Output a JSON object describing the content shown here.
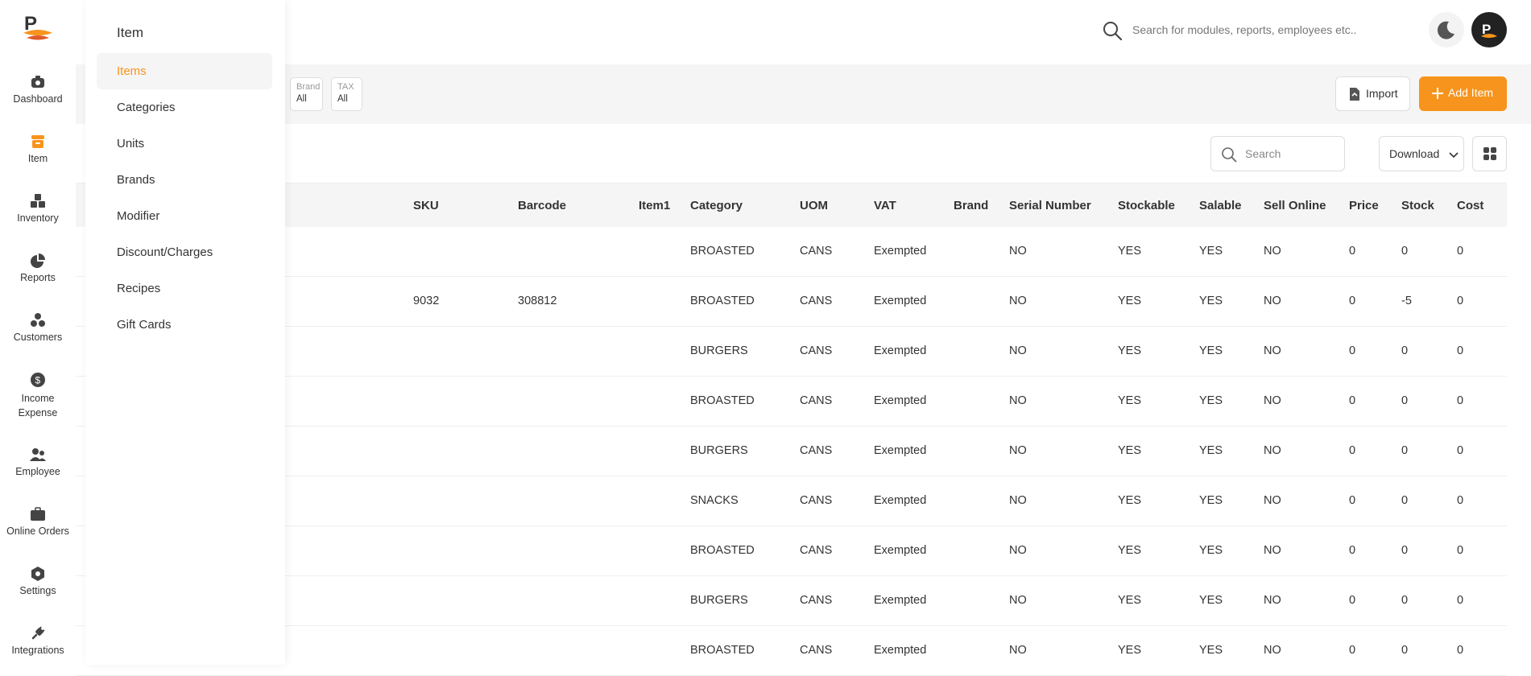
{
  "rail": [
    {
      "label": "Dashboard",
      "icon": "camera-icon"
    },
    {
      "label": "Item",
      "icon": "box-icon",
      "active": true
    },
    {
      "label": "Inventory",
      "icon": "boxes-icon"
    },
    {
      "label": "Reports",
      "icon": "pie-chart-icon"
    },
    {
      "label": "Customers",
      "icon": "users-group-icon"
    },
    {
      "label": "Income Expense",
      "icon": "dollar-icon"
    },
    {
      "label": "Employee",
      "icon": "employee-icon"
    },
    {
      "label": "Online Orders",
      "icon": "briefcase-icon"
    },
    {
      "label": "Settings",
      "icon": "settings-hex-icon"
    },
    {
      "label": "Integrations",
      "icon": "plug-icon"
    }
  ],
  "submenu": {
    "title": "Item",
    "items": [
      {
        "label": "Items",
        "active": true
      },
      {
        "label": "Categories"
      },
      {
        "label": "Units"
      },
      {
        "label": "Brands"
      },
      {
        "label": "Modifier"
      },
      {
        "label": "Discount/Charges"
      },
      {
        "label": "Recipes"
      },
      {
        "label": "Gift Cards"
      }
    ]
  },
  "topbar": {
    "search_placeholder": "Search for modules, reports, employees etc.."
  },
  "filters": [
    {
      "label": "Brand",
      "value": "All"
    },
    {
      "label": "TAX",
      "value": "All"
    }
  ],
  "actions": {
    "import_label": "Import",
    "add_label": "Add Item",
    "search_placeholder": "Search",
    "download_label": "Download"
  },
  "colors": {
    "accent": "#f7941d"
  },
  "table": {
    "columns": [
      "SKU",
      "Barcode",
      "Item1",
      "Category",
      "UOM",
      "VAT",
      "Brand",
      "Serial Number",
      "Stockable",
      "Salable",
      "Sell Online",
      "Price",
      "Stock",
      "Cost"
    ],
    "rows": [
      [
        "",
        "",
        "",
        "BROASTED",
        "CANS",
        "Exempted",
        "",
        "NO",
        "YES",
        "YES",
        "NO",
        "0",
        "0",
        "0"
      ],
      [
        "9032",
        "308812",
        "",
        "BROASTED",
        "CANS",
        "Exempted",
        "",
        "NO",
        "YES",
        "YES",
        "NO",
        "0",
        "-5",
        "0"
      ],
      [
        "",
        "",
        "",
        "BURGERS",
        "CANS",
        "Exempted",
        "",
        "NO",
        "YES",
        "YES",
        "NO",
        "0",
        "0",
        "0"
      ],
      [
        "",
        "",
        "",
        "BROASTED",
        "CANS",
        "Exempted",
        "",
        "NO",
        "YES",
        "YES",
        "NO",
        "0",
        "0",
        "0"
      ],
      [
        "",
        "",
        "",
        "BURGERS",
        "CANS",
        "Exempted",
        "",
        "NO",
        "YES",
        "YES",
        "NO",
        "0",
        "0",
        "0"
      ],
      [
        "",
        "",
        "",
        "SNACKS",
        "CANS",
        "Exempted",
        "",
        "NO",
        "YES",
        "YES",
        "NO",
        "0",
        "0",
        "0"
      ],
      [
        "",
        "",
        "",
        "BROASTED",
        "CANS",
        "Exempted",
        "",
        "NO",
        "YES",
        "YES",
        "NO",
        "0",
        "0",
        "0"
      ],
      [
        "",
        "",
        "",
        "BURGERS",
        "CANS",
        "Exempted",
        "",
        "NO",
        "YES",
        "YES",
        "NO",
        "0",
        "0",
        "0"
      ],
      [
        "",
        "",
        "",
        "BROASTED",
        "CANS",
        "Exempted",
        "",
        "NO",
        "YES",
        "YES",
        "NO",
        "0",
        "0",
        "0"
      ]
    ]
  }
}
